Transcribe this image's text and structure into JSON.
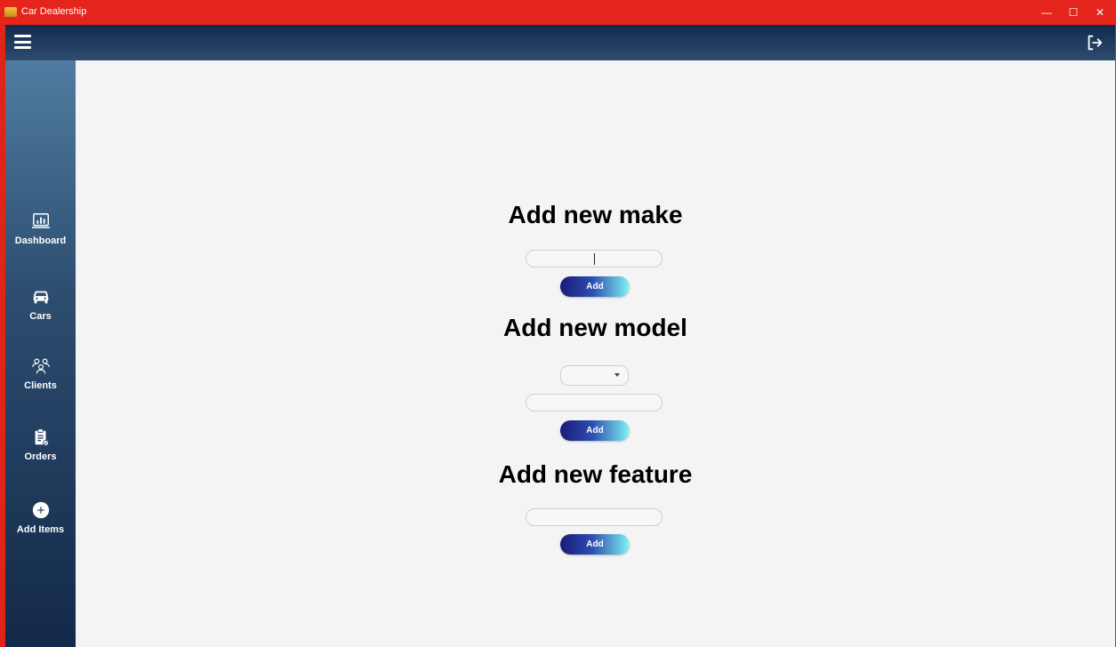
{
  "window": {
    "title": "Car Dealership",
    "minimize_glyph": "—",
    "maximize_glyph": "☐",
    "close_glyph": "✕"
  },
  "appbar": {
    "menu_icon": "hamburger-menu-icon",
    "logout_icon": "logout-icon"
  },
  "sidebar": {
    "items": [
      {
        "label": "Dashboard",
        "icon": "dashboard-chart-icon"
      },
      {
        "label": "Cars",
        "icon": "car-icon"
      },
      {
        "label": "Clients",
        "icon": "clients-group-icon"
      },
      {
        "label": "Orders",
        "icon": "clipboard-orders-icon"
      },
      {
        "label": "Add Items",
        "icon": "plus-circle-icon"
      }
    ]
  },
  "main": {
    "make": {
      "heading": "Add new make",
      "input_value": "",
      "button_label": "Add"
    },
    "model": {
      "heading": "Add new model",
      "make_select_value": "",
      "input_value": "",
      "button_label": "Add"
    },
    "feature": {
      "heading": "Add new feature",
      "input_value": "",
      "button_label": "Add"
    }
  },
  "colors": {
    "titlebar": "#e5251b",
    "appbar": "#1a3558",
    "sidebar_top": "#4f7ca1",
    "sidebar_bottom": "#13294a",
    "content_bg": "#f4f4f4",
    "button_gradient_start": "#1b1b78",
    "button_gradient_end": "#8ef4f4"
  }
}
